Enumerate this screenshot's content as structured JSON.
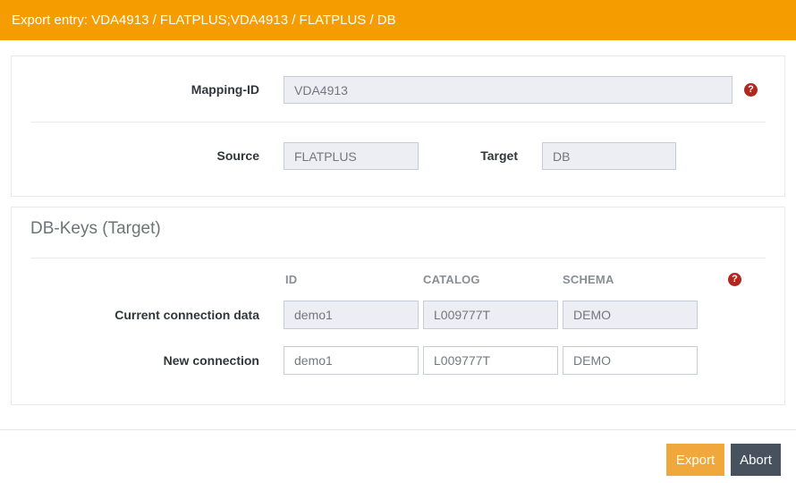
{
  "header": {
    "title": "Export entry: VDA4913 / FLATPLUS;VDA4913 / FLATPLUS / DB"
  },
  "icons": {
    "help_glyph": "?"
  },
  "mapping_panel": {
    "mapping_id": {
      "label": "Mapping-ID",
      "value": "VDA4913"
    },
    "source": {
      "label": "Source",
      "value": "FLATPLUS"
    },
    "target": {
      "label": "Target",
      "value": "DB"
    }
  },
  "db_keys_panel": {
    "heading": "DB-Keys (Target)",
    "columns": {
      "id": "ID",
      "catalog": "CATALOG",
      "schema": "SCHEMA"
    },
    "current_connection": {
      "label": "Current connection data",
      "id": "demo1",
      "catalog": "L009777T",
      "schema": "DEMO"
    },
    "new_connection": {
      "label": "New connection",
      "id": "demo1",
      "catalog": "L009777T",
      "schema": "DEMO"
    }
  },
  "footer": {
    "export_label": "Export",
    "abort_label": "Abort"
  },
  "colors": {
    "titlebar_orange": "#f49c00",
    "export_button_orange": "#f0a73c",
    "abort_button_slate": "#47525e",
    "help_icon_red": "#b3281e",
    "disabled_input_bg": "#eceef3",
    "input_border": "#c6cdd8"
  }
}
